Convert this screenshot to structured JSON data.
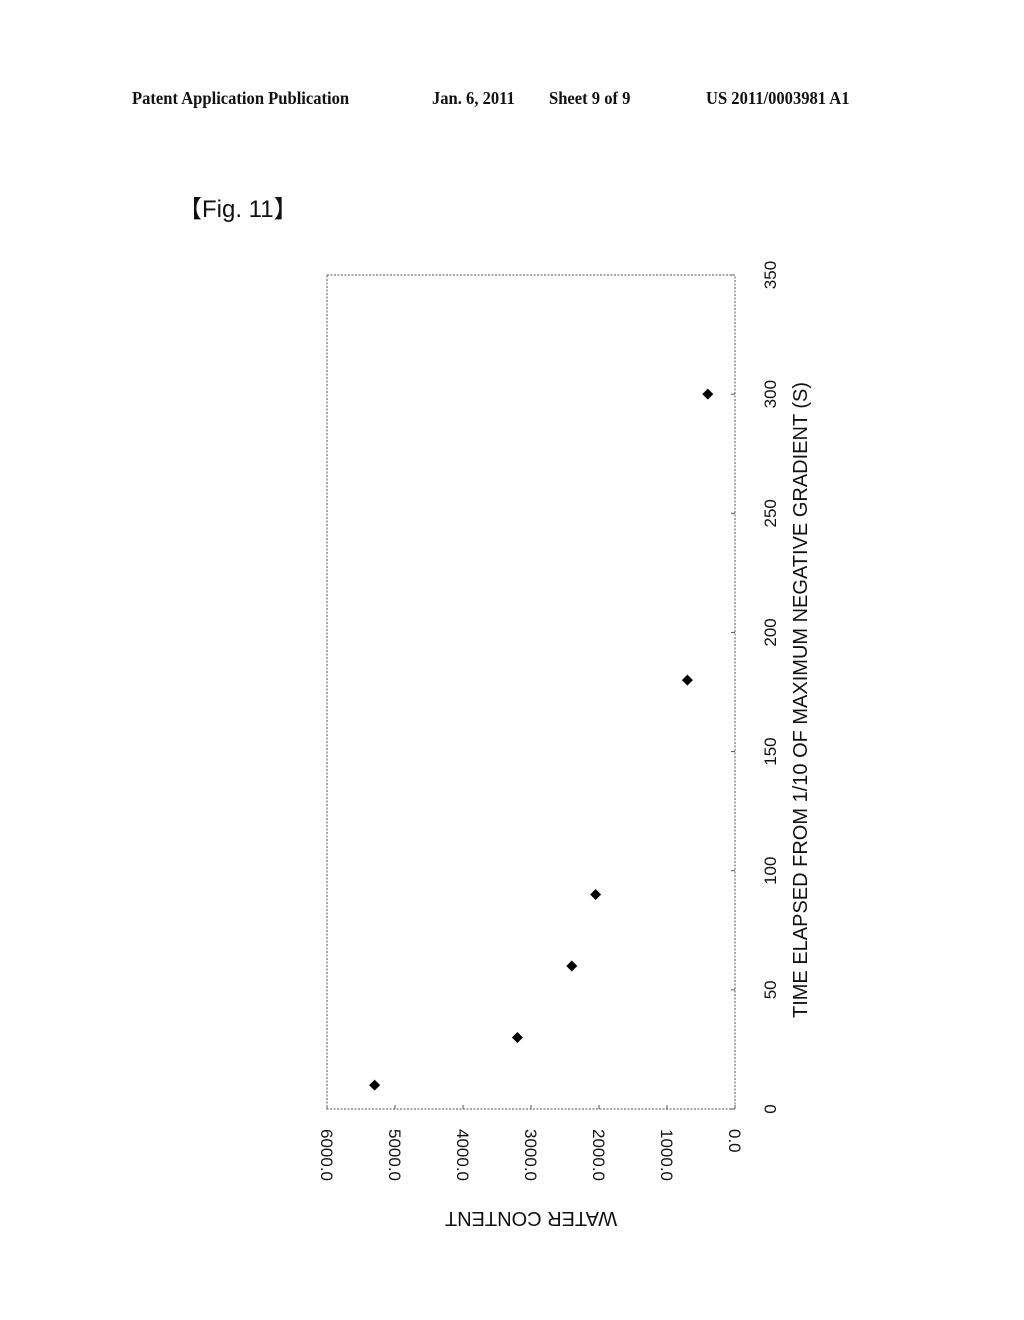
{
  "header": {
    "publication": "Patent Application Publication",
    "date": "Jan. 6, 2011",
    "sheet": "Sheet 9 of 9",
    "number": "US 2011/0003981 A1"
  },
  "figure": {
    "label": "【Fig. 11】"
  },
  "chart_data": {
    "type": "scatter",
    "orientation": "rotated 90° (page printed landscape)",
    "title": "",
    "xlabel": "TIME ELAPSED FROM 1/10 OF  MAXIMUM NEGATIVE GRADIENT (S)",
    "ylabel": "WATER CONTENT",
    "xlim": [
      0,
      350
    ],
    "ylim": [
      0,
      6000
    ],
    "xticks": [
      "0",
      "50",
      "100",
      "150",
      "200",
      "250",
      "300",
      "350"
    ],
    "yticks": [
      "0.0",
      "1000.0",
      "2000.0",
      "3000.0",
      "4000.0",
      "5000.0",
      "6000.0"
    ],
    "grid": false,
    "legend": "none",
    "marker": "diamond",
    "series": [
      {
        "name": "water content",
        "x": [
          10,
          30,
          60,
          90,
          180,
          300
        ],
        "y": [
          5300,
          3200,
          2400,
          2050,
          700,
          400
        ]
      }
    ]
  }
}
